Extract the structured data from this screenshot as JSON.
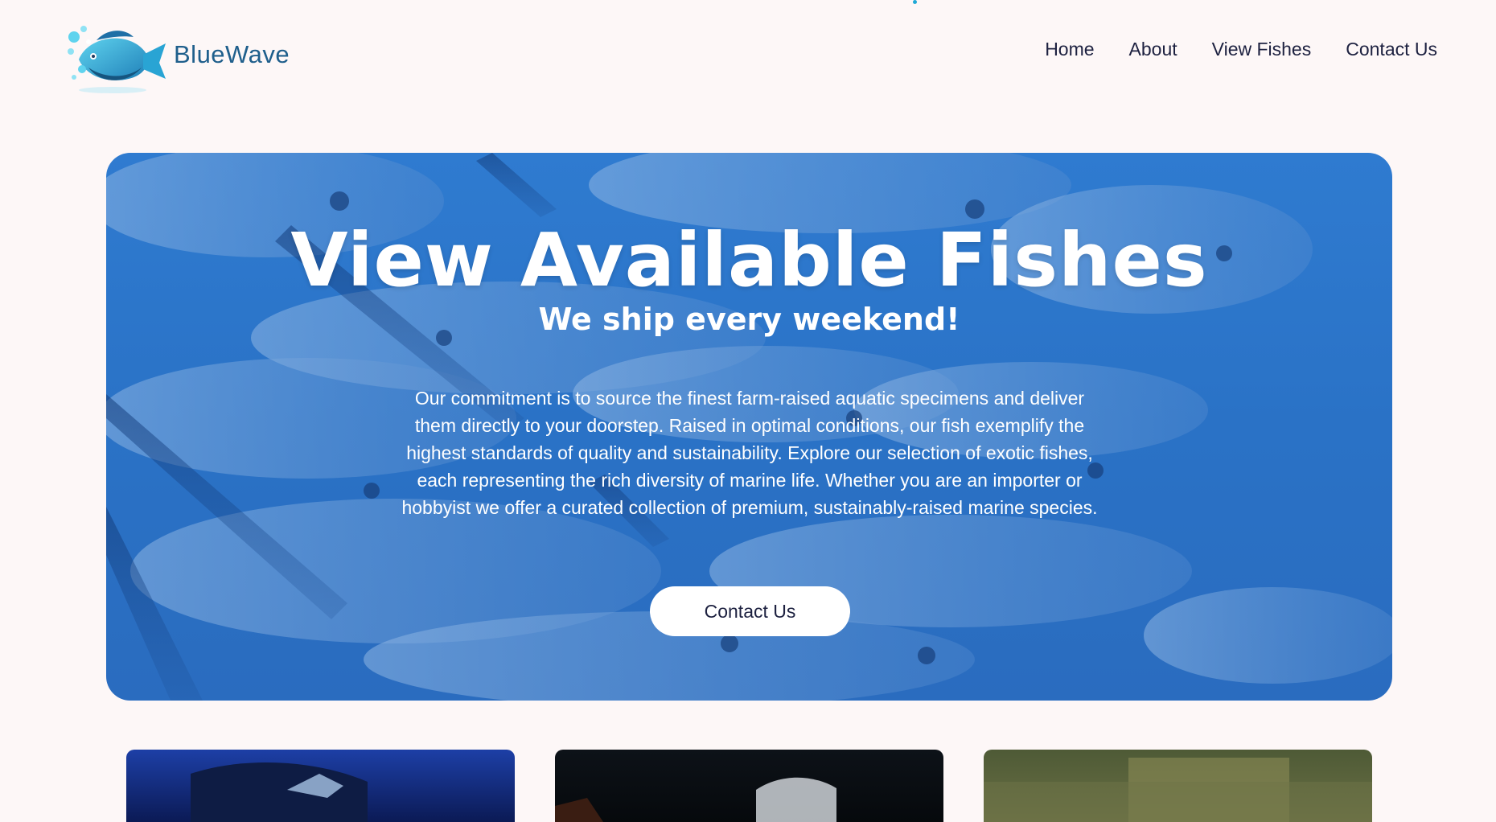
{
  "brand": {
    "name": "BlueWave",
    "logo_icon": "fish-logo-icon"
  },
  "nav": {
    "items": [
      {
        "label": "Home"
      },
      {
        "label": "About"
      },
      {
        "label": "View Fishes"
      },
      {
        "label": "Contact Us"
      }
    ]
  },
  "hero": {
    "title": "View Available Fishes",
    "subtitle": "We ship every weekend!",
    "description": "Our commitment is to source the finest farm-raised aquatic specimens and deliver them directly to your doorstep. Raised in optimal conditions, our fish exemplify the highest standards of quality and sustainability. Explore our selection of exotic fishes, each representing the rich diversity of marine life. Whether you are an importer or hobbyist we offer a curated collection of premium, sustainably-raised marine species.",
    "cta_label": "Contact Us"
  },
  "colors": {
    "page_background": "#fdf7f7",
    "brand_text": "#1f5f8c",
    "hero_blue": "#2f7bd0",
    "nav_text": "#1d2140",
    "accent_dot": "#1fa9d6"
  }
}
